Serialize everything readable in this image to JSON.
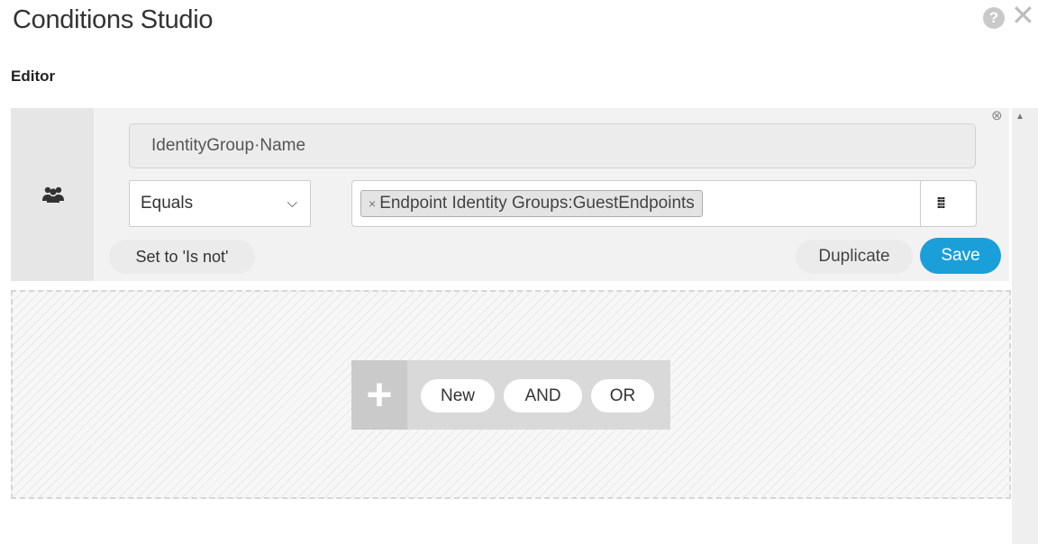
{
  "header": {
    "title": "Conditions Studio",
    "help_icon": "question-circle-icon",
    "close_icon": "close-icon"
  },
  "editor": {
    "section_label": "Editor",
    "attribute": {
      "value": "IdentityGroup·Name"
    },
    "operator": {
      "selected": "Equals",
      "icon": "chevron-down-icon"
    },
    "value": {
      "tag_remove": "×",
      "tag_label": "Endpoint Identity Groups:GuestEndpoints",
      "picker_icon": "grid-picker-icon"
    },
    "is_not_label": "Set to 'Is not'",
    "duplicate_label": "Duplicate",
    "save_label": "Save"
  },
  "add_toolbar": {
    "plus_icon": "plus-icon",
    "new_label": "New",
    "and_label": "AND",
    "or_label": "OR"
  },
  "colors": {
    "accent": "#1b9fd9"
  }
}
